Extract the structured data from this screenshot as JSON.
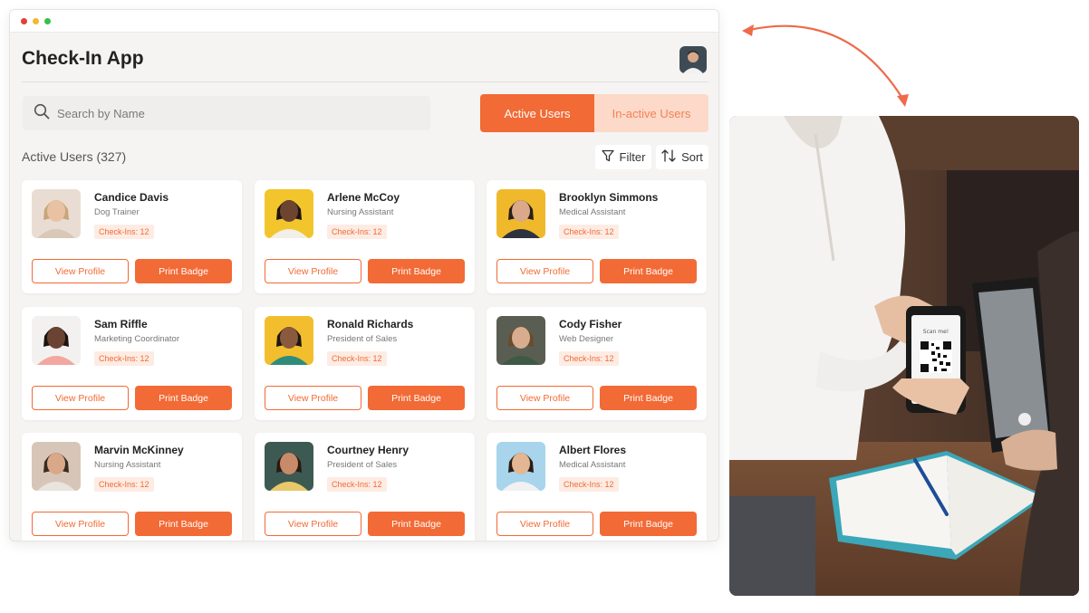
{
  "window": {
    "dots": [
      "#e0413a",
      "#f5b72b",
      "#35c04a"
    ]
  },
  "header": {
    "title": "Check-In App"
  },
  "search": {
    "placeholder": "Search by Name"
  },
  "toggle": {
    "active_label": "Active Users",
    "inactive_label": "In-active Users"
  },
  "list": {
    "section_label": "Active Users (327)",
    "filter_label": "Filter",
    "sort_label": "Sort",
    "view_label": "View Profile",
    "print_label": "Print Badge",
    "users": [
      {
        "name": "Candice Davis",
        "role": "Dog Trainer",
        "checkins": "Check-Ins: 12",
        "bg": "#e9ddd3",
        "skin": "#e8c2a2",
        "hair": "#c8a57a",
        "shirt": "#d9c8b7"
      },
      {
        "name": "Arlene McCoy",
        "role": "Nursing Assistant",
        "checkins": "Check-Ins: 12",
        "bg": "#f3c52c",
        "skin": "#6b4530",
        "hair": "#1f1510",
        "shirt": "#f2efe8"
      },
      {
        "name": "Brooklyn Simmons",
        "role": "Medical Assistant",
        "checkins": "Check-Ins: 12",
        "bg": "#f0b92b",
        "skin": "#d9a98a",
        "hair": "#2a1f1a",
        "shirt": "#2f3340"
      },
      {
        "name": "Sam Riffle",
        "role": "Marketing Coordinator",
        "checkins": "Check-Ins: 12",
        "bg": "#f3f1ef",
        "skin": "#6b4332",
        "hair": "#1c1410",
        "shirt": "#f2a7a0"
      },
      {
        "name": "Ronald Richards",
        "role": "President of Sales",
        "checkins": "Check-Ins: 12",
        "bg": "#f3be2d",
        "skin": "#8a5a3d",
        "hair": "#1f1712",
        "shirt": "#2f8c7b"
      },
      {
        "name": "Cody Fisher",
        "role": "Web Designer",
        "checkins": "Check-Ins: 12",
        "bg": "#5a5e52",
        "skin": "#d8ad8d",
        "hair": "#6b4a2e",
        "shirt": "#3e5a45"
      },
      {
        "name": "Marvin McKinney",
        "role": "Nursing Assistant",
        "checkins": "Check-Ins: 12",
        "bg": "#d7c6b8",
        "skin": "#d9a889",
        "hair": "#3a2a20",
        "shirt": "#e9e4dd"
      },
      {
        "name": "Courtney Henry",
        "role": "President of Sales",
        "checkins": "Check-Ins: 12",
        "bg": "#3d5a52",
        "skin": "#c98a6a",
        "hair": "#2a1a12",
        "shirt": "#e8c96a"
      },
      {
        "name": "Albert Flores",
        "role": "Medical Assistant",
        "checkins": "Check-Ins: 12",
        "bg": "#a8d4ec",
        "skin": "#e3b694",
        "hair": "#2a1d15",
        "shirt": "#f1f1f1"
      }
    ]
  },
  "photo": {
    "phone_text": "Scan me!"
  },
  "colors": {
    "accent": "#f26a35",
    "accent_soft": "#fcd9c8",
    "arrow": "#ee6a4a"
  }
}
